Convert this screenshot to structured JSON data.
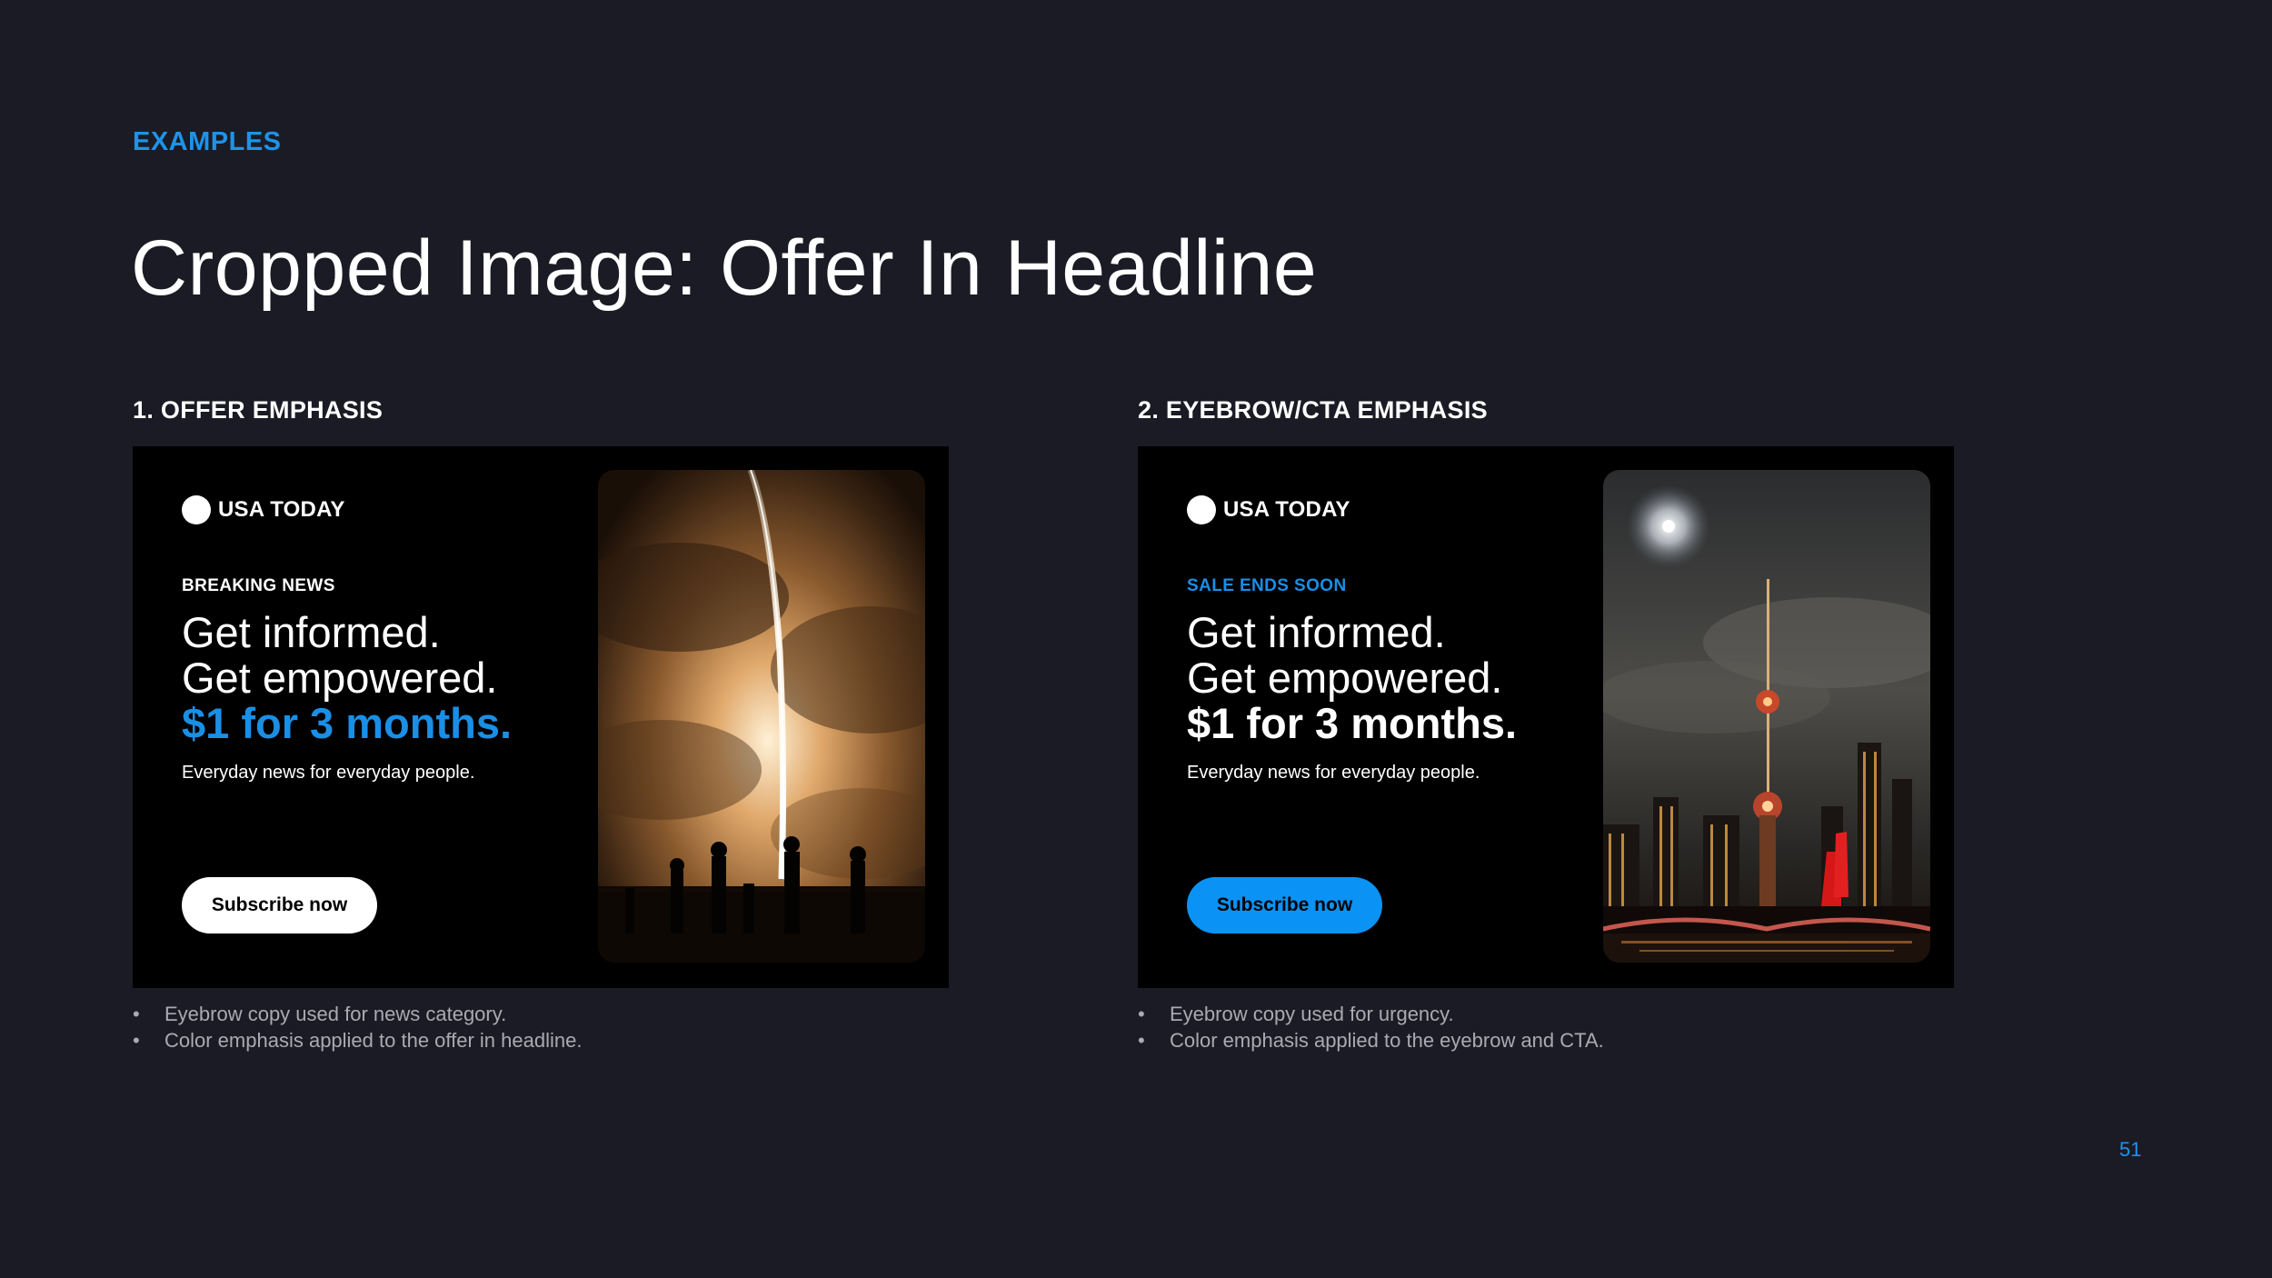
{
  "header": {
    "eyebrow": "EXAMPLES",
    "title": "Cropped Image: Offer In Headline"
  },
  "examples": [
    {
      "label": "1. OFFER EMPHASIS",
      "ad": {
        "brand": "USA TODAY",
        "eyebrow": "BREAKING NEWS",
        "eyebrow_color": "#ffffff",
        "headline_1": "Get informed.",
        "headline_2": "Get empowered.",
        "offer": "$1 for 3 months.",
        "offer_color": "#1a8fe6",
        "subline": "Everyday news for everyday people.",
        "cta": "Subscribe now",
        "cta_bg": "#ffffff",
        "cta_text_color": "#000000",
        "image": "rocket-launch-photo"
      },
      "notes": [
        "Eyebrow copy used for news category.",
        "Color emphasis applied to the offer in headline."
      ]
    },
    {
      "label": "2. EYEBROW/CTA EMPHASIS",
      "ad": {
        "brand": "USA TODAY",
        "eyebrow": "SALE ENDS SOON",
        "eyebrow_color": "#1a8fe6",
        "headline_1": "Get informed.",
        "headline_2": "Get empowered.",
        "offer": "$1 for 3 months.",
        "offer_color": "#ffffff",
        "subline": "Everyday news for everyday people.",
        "cta": "Subscribe now",
        "cta_bg": "#0a93f5",
        "cta_text_color": "#000000",
        "image": "city-skyline-night-photo"
      },
      "notes": [
        "Eyebrow copy used for urgency.",
        "Color emphasis applied to the eyebrow and CTA."
      ]
    }
  ],
  "page_number": "51",
  "colors": {
    "background": "#1a1b24",
    "accent": "#1e93e8",
    "ad_background": "#000000"
  }
}
